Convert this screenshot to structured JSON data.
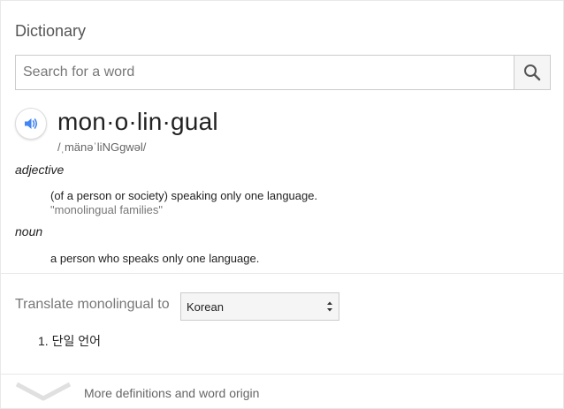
{
  "header": {
    "title": "Dictionary"
  },
  "search": {
    "placeholder": "Search for a word",
    "value": ""
  },
  "entry": {
    "word": "mon·o·lin·gual",
    "phonetic": "/ˌmänəˈliNGɡwəl/",
    "senses": [
      {
        "pos": "adjective",
        "definition": "(of a person or society) speaking only one language.",
        "example": "\"monolingual families\""
      },
      {
        "pos": "noun",
        "definition": "a person who speaks only one language."
      }
    ]
  },
  "translate": {
    "label": "Translate monolingual to",
    "selected_language": "Korean",
    "results": [
      "1. 단일 언어"
    ]
  },
  "footer": {
    "more_label": "More definitions and word origin"
  },
  "colors": {
    "accent": "#4285f4",
    "muted": "#777777"
  },
  "icons": {
    "search": "search-icon",
    "audio": "speaker-icon",
    "expand": "chevron-down-icon"
  }
}
